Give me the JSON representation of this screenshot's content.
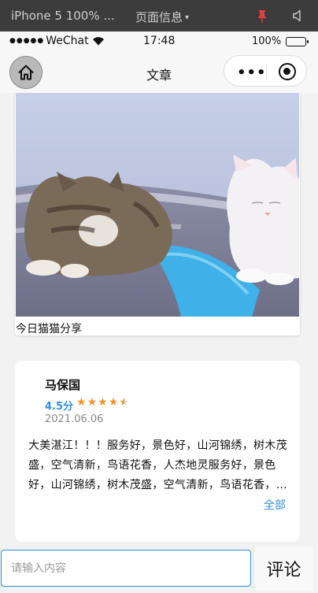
{
  "devtools": {
    "device_label": "iPhone 5 100% ...",
    "page_info_label": "页面信息",
    "caret": "▾"
  },
  "statusbar": {
    "signal": "●●●●●",
    "carrier": "WeChat",
    "time": "17:48",
    "battery": "100%"
  },
  "navbar": {
    "title": "文章",
    "more_glyph": "•••"
  },
  "post": {
    "caption": "今日猫猫分享"
  },
  "comment": {
    "name": "马保国",
    "score": "4.5分",
    "rating": 4.5,
    "max_rating": 5,
    "date": "2021.06.06",
    "text": "大美湛江！！！服务好，景色好，山河锦绣，树木茂盛，空气清新，鸟语花香，人杰地灵服务好，景色好，山河锦绣，树木茂盛，空气清新，鸟语花香，人杰地灵",
    "more_label": "全部",
    "star_color": "#f5932c",
    "score_color": "#2f8fe0"
  },
  "input": {
    "placeholder": "请输入内容",
    "submit_label": "评论"
  },
  "icons": {
    "home": "home-icon",
    "pin": "pin-icon",
    "mute": "speaker-mute-icon",
    "more": "more-dots-icon",
    "close": "capsule-close-icon"
  }
}
